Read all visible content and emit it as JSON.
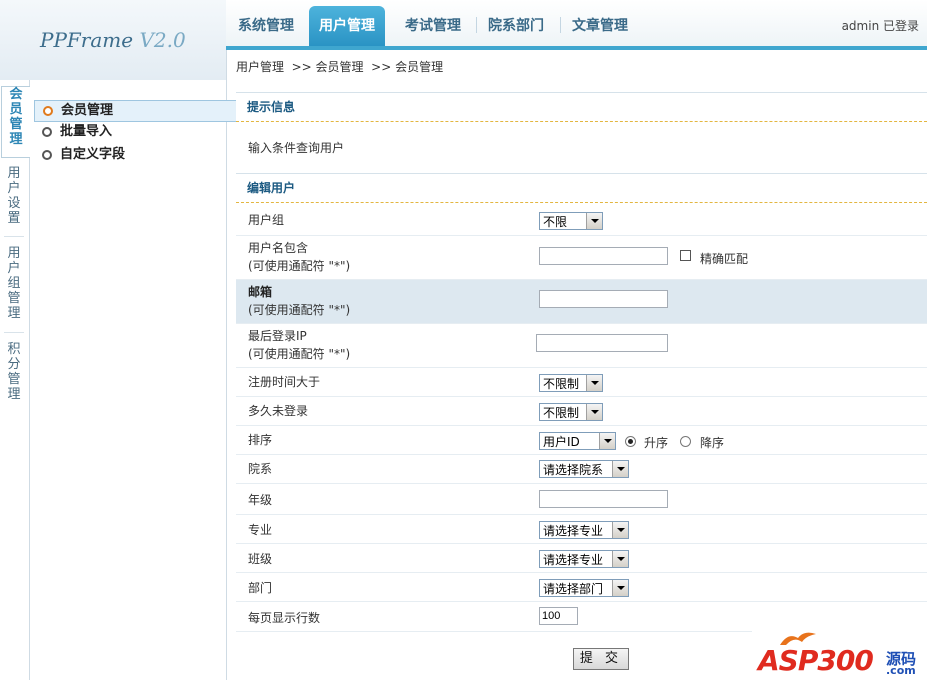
{
  "logo": {
    "brand": "PPFrame",
    "version": "V2.0"
  },
  "nav": {
    "tabs": [
      {
        "label": "系统管理",
        "active": false
      },
      {
        "label": "用户管理",
        "active": true
      },
      {
        "label": "考试管理",
        "active": false
      },
      {
        "label": "院系部门",
        "active": false
      },
      {
        "label": "文章管理",
        "active": false
      }
    ],
    "login_status": "admin 已登录"
  },
  "side_tabs": [
    {
      "label": "会员管理",
      "active": true
    },
    {
      "label": "用户设置",
      "active": false
    },
    {
      "label": "用户组管理",
      "active": false
    },
    {
      "label": "积分管理",
      "active": false
    }
  ],
  "submenu": [
    {
      "label": "会员管理",
      "active": true
    },
    {
      "label": "批量导入",
      "active": false
    },
    {
      "label": "自定义字段",
      "active": false
    }
  ],
  "breadcrumb": "用户管理  >> 会员管理  >> 会员管理",
  "hint_section": {
    "title": "提示信息",
    "text": "输入条件查询用户"
  },
  "edit_section": {
    "title": "编辑用户"
  },
  "form": {
    "user_group": {
      "label": "用户组",
      "value": "不限"
    },
    "username": {
      "label": "用户名包含",
      "sub": "(可使用通配符 \"*\")",
      "value": "",
      "exact_label": "精确匹配",
      "exact_checked": false
    },
    "email": {
      "label": "邮箱",
      "sub": "(可使用通配符 \"*\")",
      "value": ""
    },
    "last_ip": {
      "label": "最后登录IP",
      "sub": "(可使用通配符 \"*\")",
      "value": ""
    },
    "reg_time": {
      "label": "注册时间大于",
      "value": "不限制"
    },
    "inactive": {
      "label": "多久未登录",
      "value": "不限制"
    },
    "sort": {
      "label": "排序",
      "value": "用户ID",
      "asc_label": "升序",
      "desc_label": "降序",
      "order": "asc"
    },
    "department": {
      "label": "院系",
      "value": "请选择院系"
    },
    "grade": {
      "label": "年级",
      "value": ""
    },
    "major": {
      "label": "专业",
      "value": "请选择专业"
    },
    "class": {
      "label": "班级",
      "value": "请选择专业"
    },
    "division": {
      "label": "部门",
      "value": "请选择部门"
    },
    "page_size": {
      "label": "每页显示行数",
      "value": "100"
    },
    "submit_label": "提 交"
  },
  "watermark": {
    "main": "ASP300",
    "cn": "源码",
    "com": ".com"
  }
}
